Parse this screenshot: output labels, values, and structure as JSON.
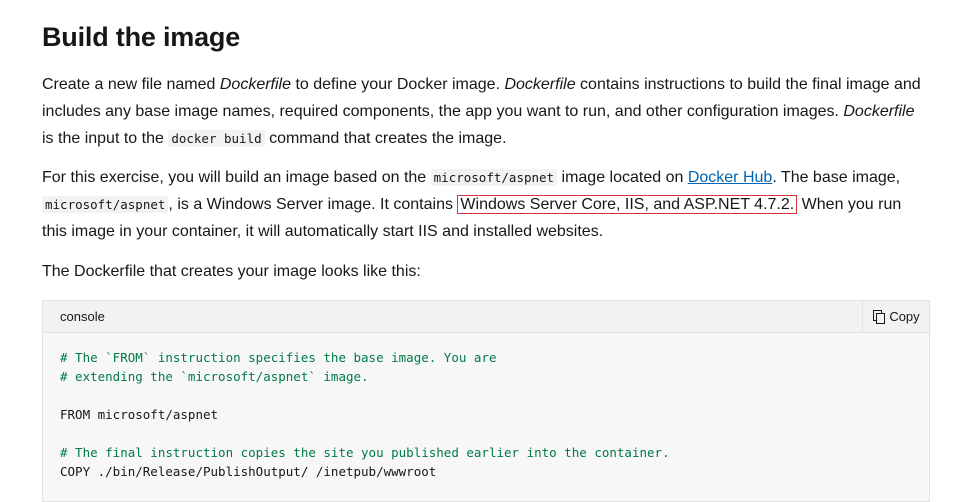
{
  "heading": "Build the image",
  "para1": {
    "t1": "Create a new file named ",
    "e1": "Dockerfile",
    "t2": " to define your Docker image. ",
    "e2": "Dockerfile",
    "t3": " contains instructions to build the final image and includes any base image names, required components, the app you want to run, and other configuration images. ",
    "e3": "Dockerfile",
    "t4": " is the input to the ",
    "c1": "docker build",
    "t5": " command that creates the image."
  },
  "para2": {
    "t1": "For this exercise, you will build an image based on the ",
    "c1": "microsoft/aspnet",
    "t2": " image located on ",
    "link": "Docker Hub",
    "t3": ". The base image, ",
    "c2": "microsoft/aspnet",
    "t4": ", is a Windows Server image. It contains ",
    "highlight": "Windows Server Core, IIS, and ASP.NET 4.7.2.",
    "t5": " When you run this image in your container, it will automatically start IIS and installed websites."
  },
  "para3": "The Dockerfile that creates your image looks like this:",
  "codeblock": {
    "language": "console",
    "copy_label": "Copy",
    "lines": [
      {
        "text": "# The `FROM` instruction specifies the base image. You are",
        "comment": true
      },
      {
        "text": "# extending the `microsoft/aspnet` image.",
        "comment": true
      },
      {
        "text": "",
        "comment": false
      },
      {
        "text": "FROM microsoft/aspnet",
        "comment": false
      },
      {
        "text": "",
        "comment": false
      },
      {
        "text": "# The final instruction copies the site you published earlier into the container.",
        "comment": true
      },
      {
        "text": "COPY ./bin/Release/PublishOutput/ /inetpub/wwwroot",
        "comment": false
      }
    ]
  },
  "colors": {
    "link": "#0065b3",
    "highlight_border": "#d13438",
    "comment": "#007a46"
  }
}
